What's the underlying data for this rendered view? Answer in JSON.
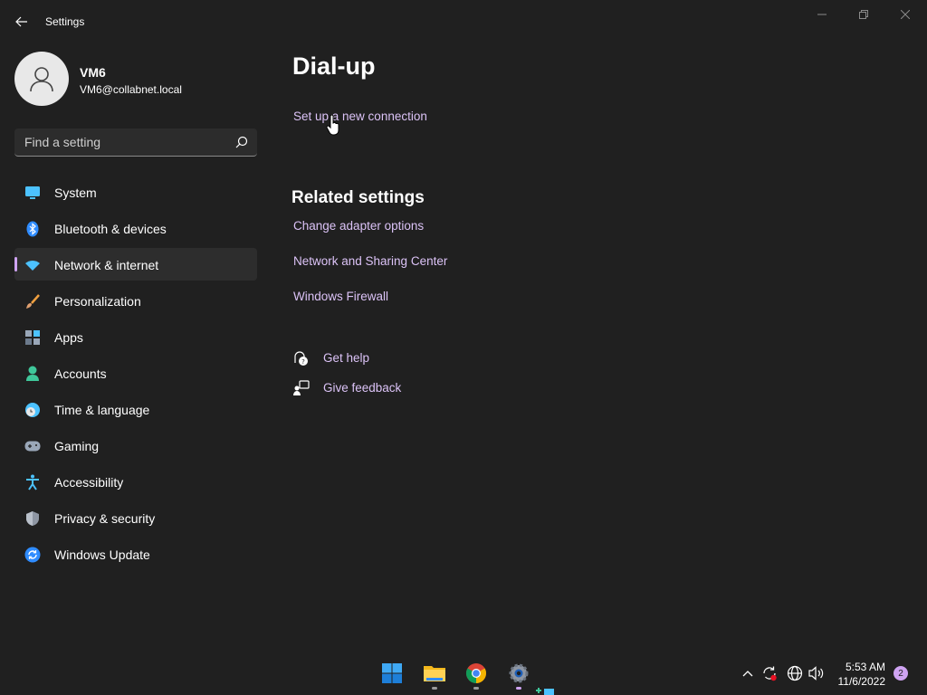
{
  "window": {
    "app_title": "Settings",
    "controls": [
      "minimize-icon",
      "maximize-icon",
      "close-icon"
    ]
  },
  "profile": {
    "name": "VM6",
    "email": "VM6@collabnet.local",
    "avatar_icon": "person-icon"
  },
  "search": {
    "placeholder": "Find a setting",
    "icon": "search-icon"
  },
  "sidebar": {
    "items": [
      {
        "label": "System",
        "icon": "monitor-icon",
        "active": false
      },
      {
        "label": "Bluetooth & devices",
        "icon": "bluetooth-icon",
        "active": false
      },
      {
        "label": "Network & internet",
        "icon": "wifi-icon",
        "active": true
      },
      {
        "label": "Personalization",
        "icon": "brush-icon",
        "active": false
      },
      {
        "label": "Apps",
        "icon": "apps-icon",
        "active": false
      },
      {
        "label": "Accounts",
        "icon": "account-icon",
        "active": false
      },
      {
        "label": "Time & language",
        "icon": "globe-clock-icon",
        "active": false
      },
      {
        "label": "Gaming",
        "icon": "gamepad-icon",
        "active": false
      },
      {
        "label": "Accessibility",
        "icon": "accessibility-icon",
        "active": false
      },
      {
        "label": "Privacy & security",
        "icon": "shield-icon",
        "active": false
      },
      {
        "label": "Windows Update",
        "icon": "update-icon",
        "active": false
      }
    ]
  },
  "main": {
    "title": "Dial-up",
    "setup_link": "Set up a new connection",
    "related": {
      "title": "Related settings",
      "links": [
        "Change adapter options",
        "Network and Sharing Center",
        "Windows Firewall"
      ]
    },
    "help": {
      "get_help": "Get help",
      "give_feedback": "Give feedback"
    }
  },
  "taskbar": {
    "apps": [
      "windows-start-icon",
      "file-explorer-icon",
      "chrome-icon",
      "settings-gear-icon"
    ],
    "time": "5:53 AM",
    "date": "11/6/2022",
    "notification_count": "2"
  },
  "colors": {
    "background": "#202020",
    "accent": "#cfa3f2",
    "link": "#dcc3f7",
    "nav_active": "#2d2d2d"
  }
}
